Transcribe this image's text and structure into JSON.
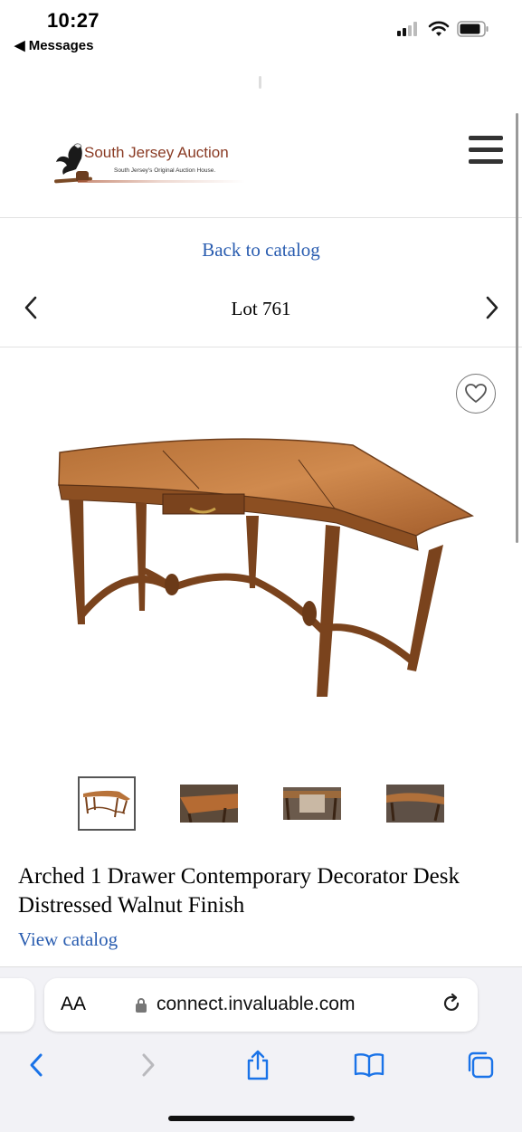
{
  "status_bar": {
    "time": "10:27",
    "back_app": "◀ Messages"
  },
  "site": {
    "logo_title": "South Jersey Auction",
    "logo_tagline": "South Jersey's Original Auction House."
  },
  "lot": {
    "back_link": "Back to catalog",
    "lot_label": "Lot 761",
    "title": "Arched 1 Drawer Contemporary Decorator Desk Distressed Walnut Finish",
    "view_catalog": "View catalog"
  },
  "browser": {
    "aa_label": "AA",
    "url": "connect.invaluable.com"
  },
  "icons": {
    "prev": "chevron-left-icon",
    "next": "chevron-right-icon",
    "favorite": "heart-icon",
    "menu": "hamburger-icon"
  },
  "colors": {
    "link": "#2a5db0",
    "ios_blue": "#1a73e8",
    "logo_brown": "#8a3b24"
  }
}
